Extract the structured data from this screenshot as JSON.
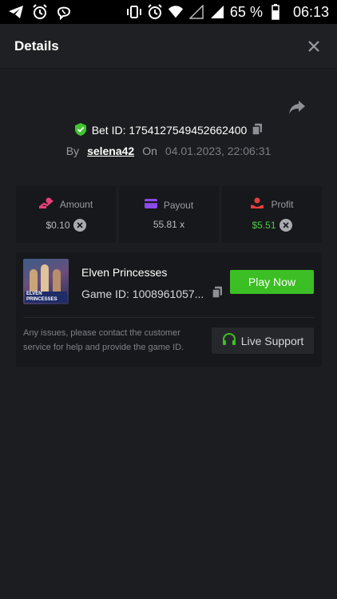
{
  "status_bar": {
    "left_icons": [
      "telegram-icon",
      "alarm-icon",
      "viber-icon"
    ],
    "right_icons": [
      "vibrate-icon",
      "alarm-icon",
      "wifi-icon",
      "signal-empty-icon",
      "signal-icon"
    ],
    "battery": "65 %",
    "time": "06:13"
  },
  "header": {
    "title": "Details"
  },
  "bet": {
    "label": "Bet ID: 1754127549452662400",
    "by_label": "By",
    "user": "selena42",
    "on_label": "On",
    "date": "04.01.2023, 22:06:31"
  },
  "stats": [
    {
      "label": "Amount",
      "value": "$0.10",
      "icon": "amount-icon",
      "icon_color": "#e8407a",
      "has_coin": true
    },
    {
      "label": "Payout",
      "value": "55.81 x",
      "icon": "card-icon",
      "icon_color": "#8a4be8",
      "has_coin": false
    },
    {
      "label": "Profit",
      "value": "$5.51",
      "icon": "profit-icon",
      "icon_color": "#e83e3e",
      "has_coin": true
    }
  ],
  "game": {
    "title": "Elven Princesses",
    "game_id": "Game ID: 1008961057...",
    "thumb_caption_1": "ELVEN",
    "thumb_caption_2": "PRINCESSES",
    "play_label": "Play Now",
    "support_text": "Any issues, please contact the customer service for help and provide the game ID.",
    "support_button": "Live Support"
  },
  "colors": {
    "background": "#1c1d20",
    "accent_green": "#3cbf24",
    "profit_green": "#4ec94a",
    "shield_green": "#3fc530"
  }
}
